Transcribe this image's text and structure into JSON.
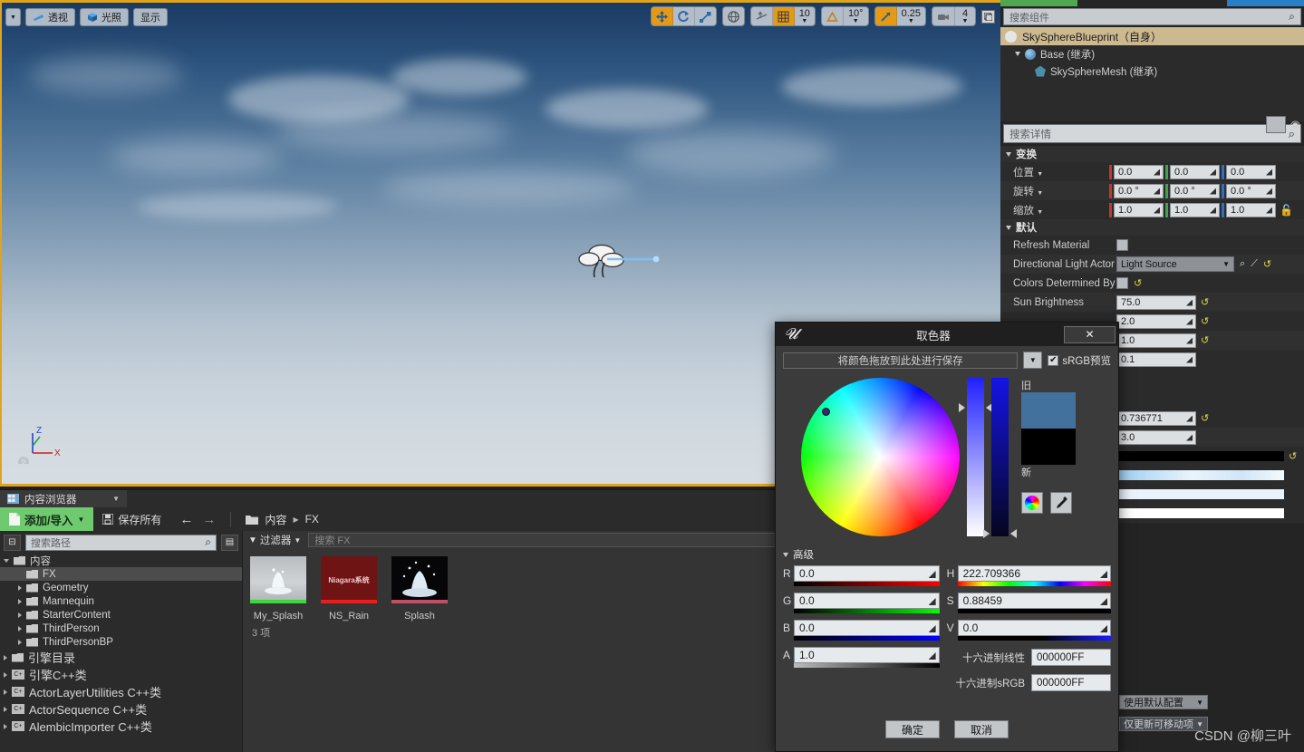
{
  "viewport": {
    "toolbar_left": [
      {
        "name": "viewport-menu",
        "label": "",
        "icon": "chevron-down-icon"
      },
      {
        "name": "perspective-button",
        "label": "透视",
        "icon": "camera-icon"
      },
      {
        "name": "lit-button",
        "label": "光照",
        "icon": "cube-icon"
      },
      {
        "name": "show-button",
        "label": "显示",
        "icon": ""
      }
    ],
    "toolbar_right": {
      "transform_group": [
        "move-icon",
        "rotate-icon",
        "scale-icon"
      ],
      "coord_space": "world-icon",
      "surface_snap": "surface-snap-icon",
      "grid_snap_on": true,
      "grid_value": "10",
      "angle_value": "10°",
      "scale_value": "0.25",
      "camera_speed": "4",
      "maximize": "maximize-icon"
    },
    "gizmo": {
      "z": "Z",
      "x": "X"
    }
  },
  "details_panel": {
    "component_search_placeholder": "搜索组件",
    "tree": [
      {
        "label": "SkySphereBlueprint（自身）",
        "icon": "sphere-icon",
        "selected": true,
        "depth": 0
      },
      {
        "label": "Base (继承)",
        "icon": "blue-sphere-icon",
        "selected": false,
        "depth": 1
      },
      {
        "label": "SkySphereMesh (继承)",
        "icon": "mesh-icon",
        "selected": false,
        "depth": 2
      }
    ],
    "details_search_placeholder": "搜索详情",
    "sections": [
      {
        "title": "变换",
        "rows": [
          {
            "label": "位置",
            "type": "vec3",
            "values": [
              "0.0",
              "0.0",
              "0.0"
            ]
          },
          {
            "label": "旋转",
            "type": "vec3",
            "values": [
              "0.0 °",
              "0.0 °",
              "0.0 °"
            ]
          },
          {
            "label": "缩放",
            "type": "vec3",
            "values": [
              "1.0",
              "1.0",
              "1.0"
            ],
            "lock": true
          }
        ]
      },
      {
        "title": "默认",
        "rows": [
          {
            "label": "Refresh Material",
            "type": "check",
            "checked": false
          },
          {
            "label": "Directional Light Actor",
            "type": "combo",
            "value": "Light Source"
          },
          {
            "label": "Colors Determined By S",
            "type": "check",
            "checked": false,
            "reset": true
          },
          {
            "label": "Sun Brightness",
            "type": "num",
            "value": "75.0",
            "reset": true
          },
          {
            "label": "",
            "type": "num",
            "value": "2.0",
            "reset": true
          },
          {
            "label": "",
            "type": "num",
            "value": "1.0",
            "reset": true
          },
          {
            "label": "",
            "type": "num",
            "value": "0.1"
          },
          {
            "label": "",
            "type": "num",
            "value": "0.736771",
            "reset": true
          },
          {
            "label": "",
            "type": "num",
            "value": "3.0"
          },
          {
            "label": "",
            "type": "swatch",
            "color": "#000000",
            "reset": true
          },
          {
            "label": "",
            "type": "swatch",
            "color": "#b9d7ef"
          },
          {
            "label": "",
            "type": "swatch",
            "color": "#e9f1f9"
          },
          {
            "label": "",
            "type": "swatch",
            "color": "#ffffff"
          }
        ]
      }
    ],
    "bottom_combos": [
      "使用默认配置",
      "仅更新可移动项"
    ]
  },
  "content_browser": {
    "tab_label": "内容浏览器",
    "toolbar": {
      "add_import": "添加/导入",
      "save_all": "保存所有",
      "back_icon": "arrow-left-icon",
      "forward_icon": "arrow-right-icon",
      "breadcrumb": [
        "内容",
        "FX"
      ]
    },
    "path_search_placeholder": "搜索路径",
    "tree": [
      {
        "label": "内容",
        "depth": 0,
        "expanded": true,
        "selected": false,
        "icon": "folder"
      },
      {
        "label": "FX",
        "depth": 1,
        "expanded": false,
        "selected": true,
        "icon": "folder"
      },
      {
        "label": "Geometry",
        "depth": 1,
        "expanded": false,
        "selected": false,
        "icon": "folder"
      },
      {
        "label": "Mannequin",
        "depth": 1,
        "expanded": false,
        "selected": false,
        "icon": "folder"
      },
      {
        "label": "StarterContent",
        "depth": 1,
        "expanded": false,
        "selected": false,
        "icon": "folder"
      },
      {
        "label": "ThirdPerson",
        "depth": 1,
        "expanded": false,
        "selected": false,
        "icon": "folder"
      },
      {
        "label": "ThirdPersonBP",
        "depth": 1,
        "expanded": false,
        "selected": false,
        "icon": "folder"
      },
      {
        "label": "引擎目录",
        "depth": 0,
        "expanded": false,
        "selected": false,
        "icon": "folder",
        "big": true
      },
      {
        "label": "引擎C++类",
        "depth": 0,
        "expanded": false,
        "selected": false,
        "icon": "cpp",
        "big": true
      },
      {
        "label": "ActorLayerUtilities C++类",
        "depth": 0,
        "expanded": false,
        "selected": false,
        "icon": "cpp",
        "big": true
      },
      {
        "label": "ActorSequence C++类",
        "depth": 0,
        "expanded": false,
        "selected": false,
        "icon": "cpp",
        "big": true
      },
      {
        "label": "AlembicImporter C++类",
        "depth": 0,
        "expanded": false,
        "selected": false,
        "icon": "cpp",
        "big": true
      }
    ],
    "filter_label": "过滤器",
    "asset_search_placeholder": "搜索 FX",
    "assets": [
      {
        "name": "My_Splash",
        "thumb_type": "splash-gray",
        "bar": "#3dd63d",
        "label_text": ""
      },
      {
        "name": "NS_Rain",
        "thumb_type": "niagara-red",
        "bar": "#e61f1f",
        "label_text": "Niagara系统"
      },
      {
        "name": "Splash",
        "thumb_type": "splash-black",
        "bar": "#c0506a",
        "label_text": ""
      }
    ],
    "status": "3 项"
  },
  "color_picker": {
    "title": "取色器",
    "close_label": "✕",
    "drop_zone": "将颜色拖放到此处进行保存",
    "srgb_preview": "sRGB预览",
    "srgb_checked": true,
    "old_label": "旧",
    "new_label": "新",
    "old_color": "#41719c",
    "new_color": "#000000",
    "advanced_label": "高级",
    "channels": [
      {
        "key": "R",
        "value": "0.0",
        "grad_from": "#000000",
        "grad_to": "#ff0000"
      },
      {
        "key": "G",
        "value": "0.0",
        "grad_from": "#000000",
        "grad_to": "#00ff00"
      },
      {
        "key": "B",
        "value": "0.0",
        "grad_from": "#000000",
        "grad_to": "#0000ff"
      },
      {
        "key": "A",
        "value": "1.0",
        "grad_from": "#000000",
        "grad_to": "#ffffff"
      }
    ],
    "hsv": [
      {
        "key": "H",
        "value": "222.709366",
        "grad": "hue"
      },
      {
        "key": "S",
        "value": "0.88459",
        "grad_from": "#000000",
        "grad_to": "#2222ff"
      },
      {
        "key": "V",
        "value": "0.0",
        "grad_from": "#000000",
        "grad_to": "#1111ff"
      }
    ],
    "hex_linear_label": "十六进制线性",
    "hex_linear_value": "000000FF",
    "hex_srgb_label": "十六进制sRGB",
    "hex_srgb_value": "000000FF",
    "ok_label": "确定",
    "cancel_label": "取消",
    "wheel_icon": "color-wheel-icon",
    "eyedropper_icon": "eyedropper-icon"
  },
  "watermark": "CSDN @柳三叶"
}
